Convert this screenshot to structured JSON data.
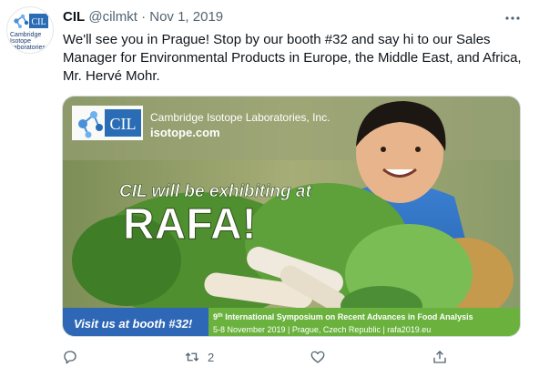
{
  "tweet": {
    "author_name": "CIL",
    "handle": "@cilmkt",
    "separator": "·",
    "date": "Nov 1, 2019",
    "text": "We'll see you in Prague! Stop by our booth #32 and say hi to our Sales Manager for Environmental Products in Europe, the Middle East, and Africa, Mr. Hervé Mohr.",
    "avatar": {
      "logo_text": "CIL",
      "caption": "Cambridge Isotope Laboratories"
    }
  },
  "media": {
    "logo_text": "CIL",
    "company": "Cambridge Isotope Laboratories, Inc.",
    "website": "isotope.com",
    "exhibit_line": "CIL will be exhibiting at",
    "event": "RAFA!",
    "booth": "Visit us at booth #32!",
    "symposium_num": "9",
    "symposium_suffix": "th",
    "symposium_title": "International Symposium on Recent Advances in Food Analysis",
    "symposium_details": "5-8 November 2019 | Prague, Czech Republic | rafa2019.eu"
  },
  "actions": {
    "reply": {
      "icon": "reply-icon",
      "count": ""
    },
    "retweet": {
      "icon": "retweet-icon",
      "count": "2"
    },
    "like": {
      "icon": "heart-icon",
      "count": ""
    },
    "share": {
      "icon": "share-icon",
      "count": ""
    }
  },
  "colors": {
    "text": "#0f1419",
    "secondary": "#536471",
    "cil_blue": "#2a6db5",
    "green_banner": "#6ab23d"
  }
}
